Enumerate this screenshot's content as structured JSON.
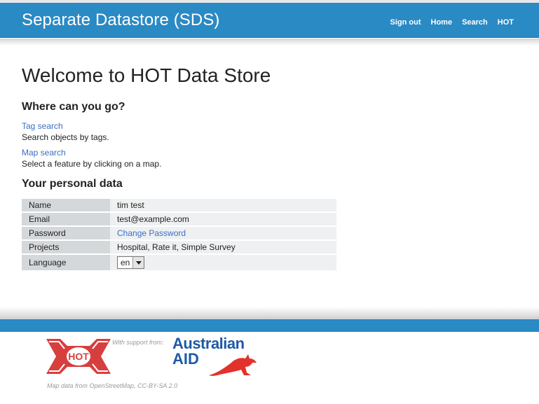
{
  "header": {
    "title": "Separate Datastore (SDS)",
    "nav": [
      "Sign out",
      "Home",
      "Search",
      "HOT"
    ]
  },
  "main": {
    "heading": "Welcome to HOT Data Store",
    "where_heading": "Where can you go?",
    "links": [
      {
        "label": "Tag search",
        "desc": "Search objects by tags."
      },
      {
        "label": "Map search",
        "desc": "Select a feature by clicking on a map."
      }
    ],
    "personal_heading": "Your personal data",
    "personal": {
      "name_label": "Name",
      "name_value": "tim test",
      "email_label": "Email",
      "email_value": "test@example.com",
      "password_label": "Password",
      "password_link": "Change Password",
      "projects_label": "Projects",
      "projects_value": "Hospital, Rate it, Simple Survey",
      "language_label": "Language",
      "language_value": "en"
    }
  },
  "footer": {
    "hot_logo_text": "HOT",
    "support_text": "With support from:",
    "aus_logo_line1": "Australian",
    "aus_logo_line2": "AID",
    "map_credit": "Map data from OpenStreetMap, CC-BY-SA 2.0"
  },
  "colors": {
    "header_blue": "#2a8ac4",
    "link_blue": "#3b6fc2",
    "hot_red": "#d73f3f",
    "aus_blue": "#1f5aa6",
    "kangaroo_red": "#e2322c"
  }
}
